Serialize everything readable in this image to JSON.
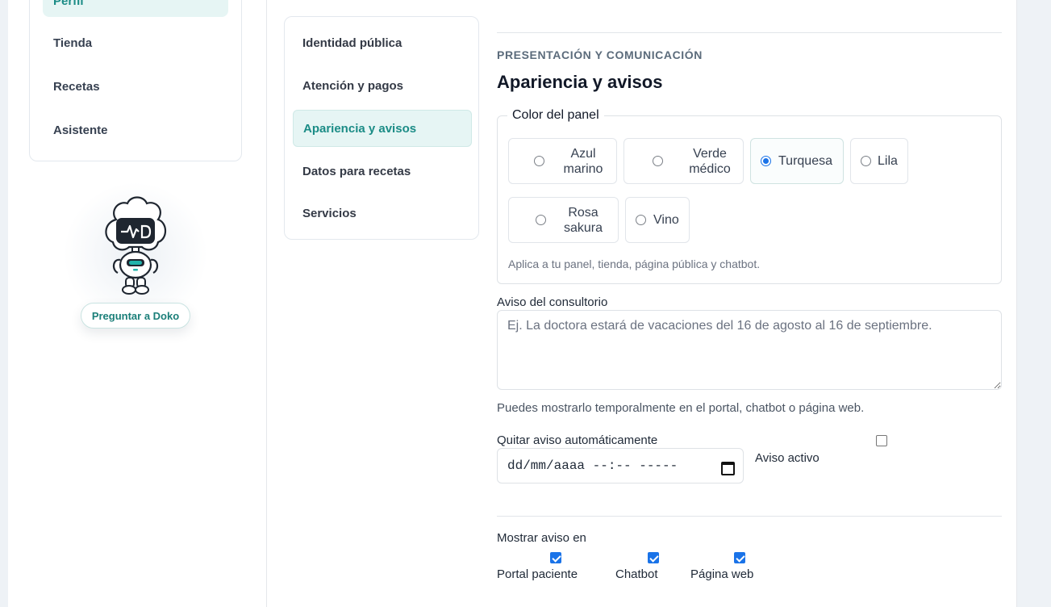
{
  "sidebar": {
    "items": [
      {
        "label": "Perfil",
        "active": true
      },
      {
        "label": "Tienda",
        "active": false
      },
      {
        "label": "Recetas",
        "active": false
      },
      {
        "label": "Asistente",
        "active": false
      }
    ],
    "assistant": {
      "icon": "doko-robot-icon",
      "button_label": "Preguntar a Doko"
    }
  },
  "settings_nav": {
    "items": [
      {
        "label": "Identidad pública",
        "active": false
      },
      {
        "label": "Atención y pagos",
        "active": false
      },
      {
        "label": "Apariencia y avisos",
        "active": true
      },
      {
        "label": "Datos para recetas",
        "active": false
      },
      {
        "label": "Servicios",
        "active": false
      }
    ]
  },
  "section": {
    "eyebrow": "PRESENTACIÓN Y COMUNICACIÓN",
    "title": "Apariencia y avisos"
  },
  "panel_color": {
    "legend": "Color del panel",
    "options": [
      {
        "line1": "Azul",
        "line2": "marino",
        "selected": false
      },
      {
        "line1": "Verde",
        "line2": "médico",
        "selected": false
      },
      {
        "line1": "Turquesa",
        "line2": "",
        "selected": true
      },
      {
        "line1": "Lila",
        "line2": "",
        "selected": false
      },
      {
        "line1": "Rosa",
        "line2": "sakura",
        "selected": false
      },
      {
        "line1": "Vino",
        "line2": "",
        "selected": false
      }
    ],
    "help": "Aplica a tu panel, tienda, página pública y chatbot."
  },
  "notice": {
    "label": "Aviso del consultorio",
    "placeholder": "Ej. La doctora estará de vacaciones del 16 de agosto al 16 de septiembre.",
    "help": "Puedes mostrarlo temporalmente en el portal, chatbot o página web.",
    "auto_remove_label": "Quitar aviso automáticamente",
    "date_value": "dd/mm/aaaa --:-- -----",
    "active_label": "Aviso activo",
    "active_checked": false
  },
  "show_notice": {
    "label": "Mostrar aviso en",
    "targets": [
      {
        "label": "Portal paciente",
        "checked": true
      },
      {
        "label": "Chatbot",
        "checked": true
      },
      {
        "label": "Página web",
        "checked": true
      }
    ]
  },
  "colors": {
    "accent": "#1b8c86",
    "accent_bg": "#e6f5f4",
    "checkbox": "#1a73e8"
  }
}
